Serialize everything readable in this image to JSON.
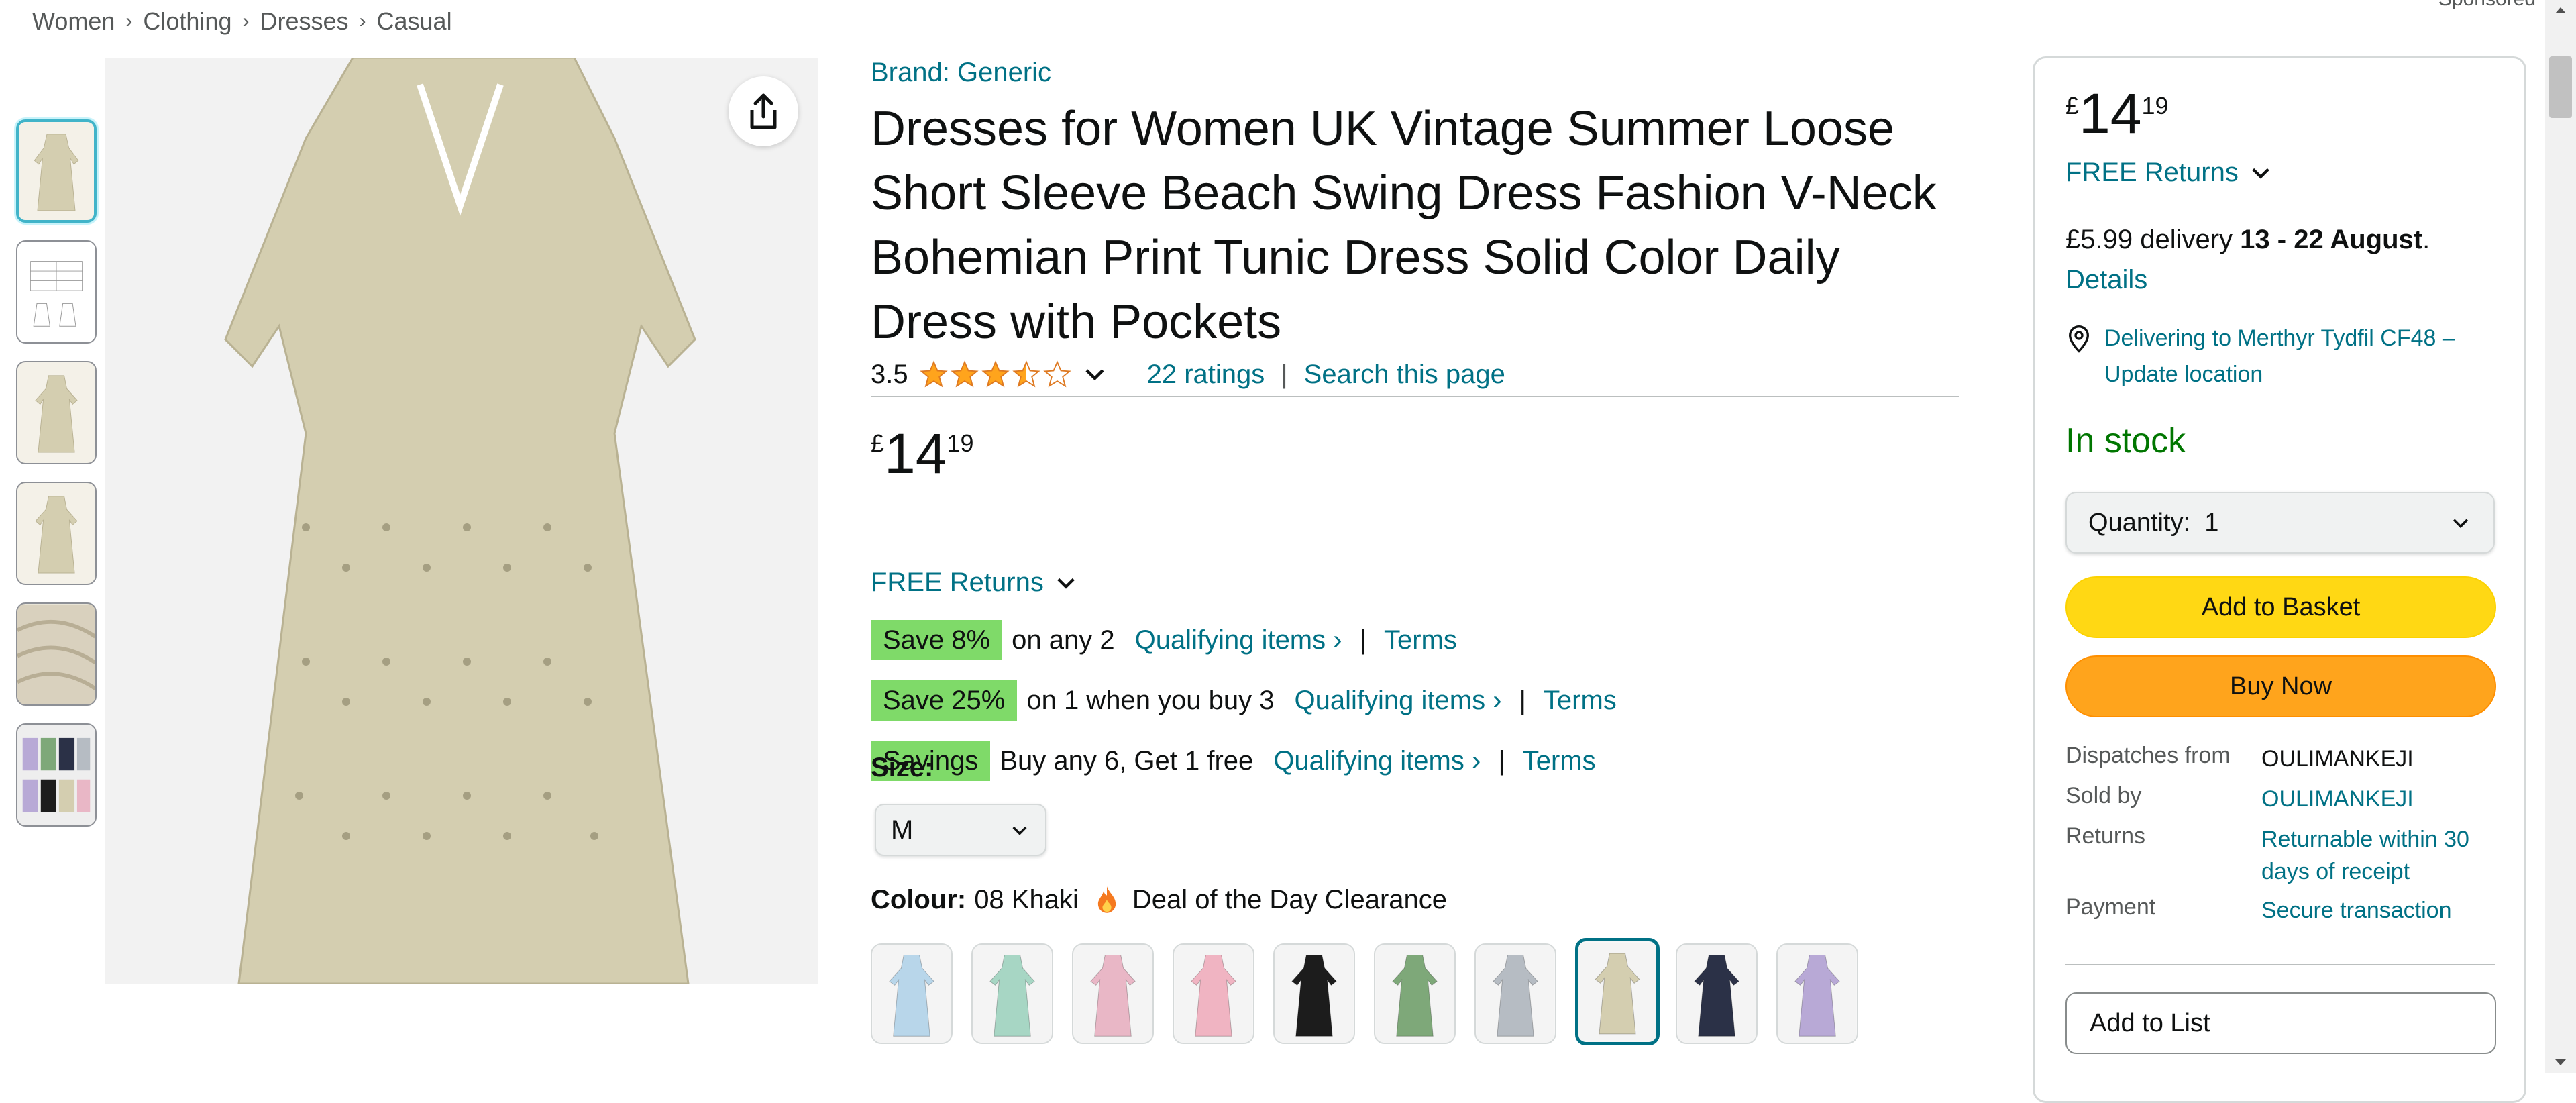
{
  "breadcrumb": [
    "Women",
    "Clothing",
    "Dresses",
    "Casual"
  ],
  "sponsored": "Sponsored",
  "product": {
    "brand": "Brand: Generic",
    "title": "Dresses for Women UK Vintage Summer Loose Short Sleeve Beach Swing Dress Fashion V-Neck Bohemian Print Tunic Dress Solid Color Daily Dress with Pockets",
    "rating": "3.5",
    "rating_fraction": 0.7,
    "ratings_count": "22 ratings",
    "search_page": "Search this page",
    "price": {
      "currency": "£",
      "whole": "14",
      "fraction": "19"
    },
    "free_returns": "FREE Returns"
  },
  "promos": [
    {
      "badge": "Save 8%",
      "text": "on any 2",
      "link": "Qualifying items",
      "terms": "Terms"
    },
    {
      "badge": "Save 25%",
      "text": "on 1 when you buy 3",
      "link": "Qualifying items",
      "terms": "Terms"
    },
    {
      "badge": "Savings",
      "text": "Buy any 6, Get 1 free",
      "link": "Qualifying items",
      "terms": "Terms"
    }
  ],
  "size": {
    "label": "Size:",
    "selected": "M"
  },
  "colour": {
    "label": "Colour:",
    "value": "08 Khaki",
    "deal": "Deal of the Day Clearance"
  },
  "swatch_colors": [
    "#b8d6ea",
    "#a7d6c4",
    "#e9b7c6",
    "#f0b4c2",
    "#1c1c1c",
    "#7ea879",
    "#b6bcc3",
    "#d4ceb0",
    "#2b3147",
    "#b8a9d6"
  ],
  "thumb_colors": [
    "#d4ceb0",
    "#ffffff",
    "#d4ceb0",
    "#d4ceb0",
    "#d9d1be",
    "#b8a9d6"
  ],
  "buybox": {
    "price": {
      "currency": "£",
      "whole": "14",
      "fraction": "19"
    },
    "free_returns": "FREE Returns",
    "delivery_prefix": "£5.99 delivery",
    "delivery_dates": "13 - 22 August",
    "delivery_suffix": ".",
    "details_link": "Details",
    "location": "Delivering to Merthyr Tydfil CF48 – Update location",
    "stock": "In stock",
    "quantity_label": "Quantity:",
    "quantity_value": "1",
    "add_to_basket": "Add to Basket",
    "buy_now": "Buy Now",
    "dispatches_label": "Dispatches from",
    "dispatches_value": "OULIMANKEJI",
    "sold_by_label": "Sold by",
    "sold_by_value": "OULIMANKEJI",
    "returns_label": "Returns",
    "returns_value": "Returnable within 30 days of receipt",
    "payment_label": "Payment",
    "payment_value": "Secure transaction",
    "add_to_list": "Add to List"
  },
  "colors": {
    "link": "#007185",
    "badge_green": "#7fda69",
    "basket_yellow": "#ffd814",
    "buy_orange": "#ffa41c",
    "stock_green": "#007600",
    "star_orange": "#ffa41c"
  }
}
